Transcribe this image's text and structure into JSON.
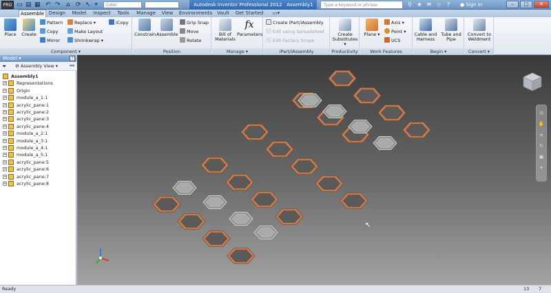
{
  "titlebar": {
    "logo_text": "PRO",
    "color_select": "Color",
    "app_title": "Autodesk Inventor Professional 2012",
    "doc_title": "Assembly1",
    "search_placeholder": "Type a keyword or phrase",
    "sign_in": "Sign In",
    "icons": [
      "new-icon",
      "open-icon",
      "save-icon",
      "undo-icon",
      "redo-icon",
      "home-icon",
      "update-icon",
      "select-icon",
      "measure-icon"
    ]
  },
  "tabs": [
    {
      "label": "Assemble",
      "active": true
    },
    {
      "label": "Design"
    },
    {
      "label": "Model"
    },
    {
      "label": "Inspect"
    },
    {
      "label": "Tools"
    },
    {
      "label": "Manage"
    },
    {
      "label": "View"
    },
    {
      "label": "Environments"
    },
    {
      "label": "Vault"
    },
    {
      "label": "Get Started"
    }
  ],
  "ribbon": {
    "component": {
      "title": "Component",
      "place": "Place",
      "create": "Create",
      "pattern": "Pattern",
      "copy": "Copy",
      "mirror": "Mirror",
      "replace": "Replace",
      "make_layout": "Make Layout",
      "shrinkwrap": "Shrinkwrap",
      "icopy": "iCopy"
    },
    "position": {
      "title": "Position",
      "constrain": "Constrain",
      "assemble": "Assemble",
      "grip_snap": "Grip Snap",
      "move": "Move",
      "rotate": "Rotate"
    },
    "manage": {
      "title": "Manage",
      "bom_line1": "Bill of",
      "bom_line2": "Materials",
      "parameters": "Parameters"
    },
    "ipart": {
      "title": "iPart/iAssembly",
      "create": "Create iPart/iAssembly",
      "edit_spreadsheet": "Edit using Spreadsheet",
      "edit_factory": "Edit Factory Scope"
    },
    "productivity": {
      "title": "Productivity",
      "create_substitutes_line1": "Create",
      "create_substitutes_line2": "Substitutes"
    },
    "work_features": {
      "title": "Work Features",
      "plane": "Plane",
      "axis": "Axis",
      "point": "Point",
      "ucs": "UCS"
    },
    "begin": {
      "title": "Begin",
      "cable_line1": "Cable and",
      "cable_line2": "Harness",
      "tube_line1": "Tube and",
      "tube_line2": "Pipe"
    },
    "convert": {
      "title": "Convert",
      "weldment_line1": "Convert to",
      "weldment_line2": "Weldment"
    }
  },
  "browser": {
    "title": "Model",
    "help": "?",
    "view_select": "Assembly View",
    "tree": [
      {
        "label": "Assembly1",
        "root": true
      },
      {
        "label": "Representations"
      },
      {
        "label": "Origin"
      },
      {
        "label": "module_a_1:1"
      },
      {
        "label": "acrylic_pane:1"
      },
      {
        "label": "acrylic_pane:2"
      },
      {
        "label": "acrylic_pane:3"
      },
      {
        "label": "acrylic_pane:4"
      },
      {
        "label": "module_a_2:1"
      },
      {
        "label": "module_a_3:1"
      },
      {
        "label": "module_a_4:1"
      },
      {
        "label": "module_a_5:1"
      },
      {
        "label": "acrylic_pane:5"
      },
      {
        "label": "acrylic_pane:6"
      },
      {
        "label": "acrylic_pane:7"
      },
      {
        "label": "acrylic_pane:8"
      }
    ]
  },
  "status": {
    "text": "Ready",
    "count1": "13",
    "count2": "7"
  },
  "colors": {
    "copper": "#c8845a",
    "copper_dark": "#8b5234",
    "acrylic": "#a9aba8",
    "viewport_top": "#3a3a3a",
    "viewport_bottom": "#a3a3a3"
  }
}
